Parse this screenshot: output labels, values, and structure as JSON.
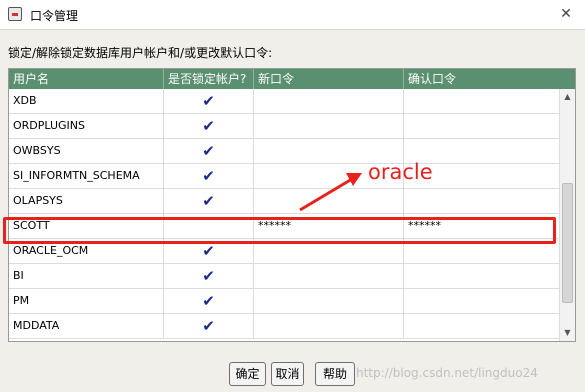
{
  "window": {
    "title": "口令管理",
    "close_symbol": "✕"
  },
  "instruction": "锁定/解除锁定数据库用户帐户和/或更改默认口令:",
  "table": {
    "headers": [
      "用户名",
      "是否锁定帐户?",
      "新口令",
      "确认口令"
    ],
    "rows": [
      {
        "user": "XDB",
        "locked": true,
        "new_password": "",
        "confirm_password": ""
      },
      {
        "user": "ORDPLUGINS",
        "locked": true,
        "new_password": "",
        "confirm_password": ""
      },
      {
        "user": "OWBSYS",
        "locked": true,
        "new_password": "",
        "confirm_password": ""
      },
      {
        "user": "SI_INFORMTN_SCHEMA",
        "locked": true,
        "new_password": "",
        "confirm_password": ""
      },
      {
        "user": "OLAPSYS",
        "locked": true,
        "new_password": "",
        "confirm_password": ""
      },
      {
        "user": "SCOTT",
        "locked": false,
        "new_password": "******",
        "confirm_password": "******"
      },
      {
        "user": "ORACLE_OCM",
        "locked": true,
        "new_password": "",
        "confirm_password": ""
      },
      {
        "user": "BI",
        "locked": true,
        "new_password": "",
        "confirm_password": ""
      },
      {
        "user": "PM",
        "locked": true,
        "new_password": "",
        "confirm_password": ""
      },
      {
        "user": "MDDATA",
        "locked": true,
        "new_password": "",
        "confirm_password": ""
      }
    ],
    "check_symbol": "✔"
  },
  "annotation": {
    "text": "oracle",
    "color": "#e8211d"
  },
  "buttons": {
    "ok": "确定",
    "cancel": "取消",
    "help": "帮助"
  },
  "watermark": "http://blog.csdn.net/lingduo24",
  "colors": {
    "header_bg": "#5a8f6f",
    "check": "#1c2a8c",
    "highlight": "#e8211d"
  }
}
